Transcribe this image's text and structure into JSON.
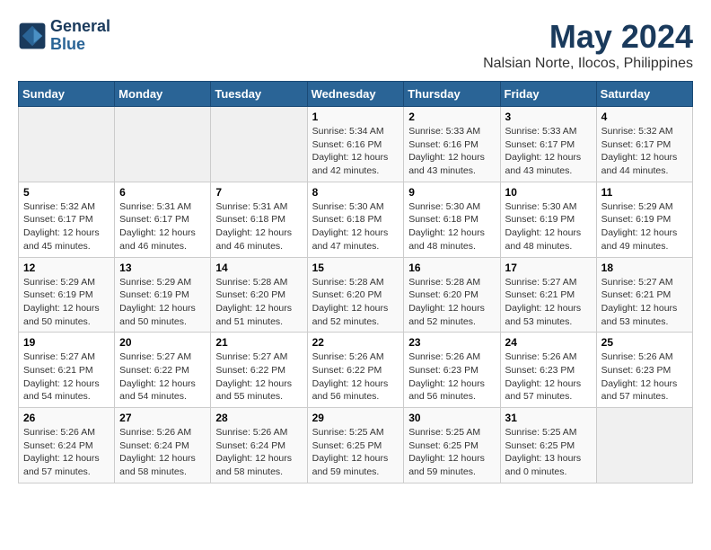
{
  "header": {
    "logo_line1": "General",
    "logo_line2": "Blue",
    "title": "May 2024",
    "subtitle": "Nalsian Norte, Ilocos, Philippines"
  },
  "weekdays": [
    "Sunday",
    "Monday",
    "Tuesday",
    "Wednesday",
    "Thursday",
    "Friday",
    "Saturday"
  ],
  "weeks": [
    [
      {
        "day": "",
        "info": ""
      },
      {
        "day": "",
        "info": ""
      },
      {
        "day": "",
        "info": ""
      },
      {
        "day": "1",
        "info": "Sunrise: 5:34 AM\nSunset: 6:16 PM\nDaylight: 12 hours\nand 42 minutes."
      },
      {
        "day": "2",
        "info": "Sunrise: 5:33 AM\nSunset: 6:16 PM\nDaylight: 12 hours\nand 43 minutes."
      },
      {
        "day": "3",
        "info": "Sunrise: 5:33 AM\nSunset: 6:17 PM\nDaylight: 12 hours\nand 43 minutes."
      },
      {
        "day": "4",
        "info": "Sunrise: 5:32 AM\nSunset: 6:17 PM\nDaylight: 12 hours\nand 44 minutes."
      }
    ],
    [
      {
        "day": "5",
        "info": "Sunrise: 5:32 AM\nSunset: 6:17 PM\nDaylight: 12 hours\nand 45 minutes."
      },
      {
        "day": "6",
        "info": "Sunrise: 5:31 AM\nSunset: 6:17 PM\nDaylight: 12 hours\nand 46 minutes."
      },
      {
        "day": "7",
        "info": "Sunrise: 5:31 AM\nSunset: 6:18 PM\nDaylight: 12 hours\nand 46 minutes."
      },
      {
        "day": "8",
        "info": "Sunrise: 5:30 AM\nSunset: 6:18 PM\nDaylight: 12 hours\nand 47 minutes."
      },
      {
        "day": "9",
        "info": "Sunrise: 5:30 AM\nSunset: 6:18 PM\nDaylight: 12 hours\nand 48 minutes."
      },
      {
        "day": "10",
        "info": "Sunrise: 5:30 AM\nSunset: 6:19 PM\nDaylight: 12 hours\nand 48 minutes."
      },
      {
        "day": "11",
        "info": "Sunrise: 5:29 AM\nSunset: 6:19 PM\nDaylight: 12 hours\nand 49 minutes."
      }
    ],
    [
      {
        "day": "12",
        "info": "Sunrise: 5:29 AM\nSunset: 6:19 PM\nDaylight: 12 hours\nand 50 minutes."
      },
      {
        "day": "13",
        "info": "Sunrise: 5:29 AM\nSunset: 6:19 PM\nDaylight: 12 hours\nand 50 minutes."
      },
      {
        "day": "14",
        "info": "Sunrise: 5:28 AM\nSunset: 6:20 PM\nDaylight: 12 hours\nand 51 minutes."
      },
      {
        "day": "15",
        "info": "Sunrise: 5:28 AM\nSunset: 6:20 PM\nDaylight: 12 hours\nand 52 minutes."
      },
      {
        "day": "16",
        "info": "Sunrise: 5:28 AM\nSunset: 6:20 PM\nDaylight: 12 hours\nand 52 minutes."
      },
      {
        "day": "17",
        "info": "Sunrise: 5:27 AM\nSunset: 6:21 PM\nDaylight: 12 hours\nand 53 minutes."
      },
      {
        "day": "18",
        "info": "Sunrise: 5:27 AM\nSunset: 6:21 PM\nDaylight: 12 hours\nand 53 minutes."
      }
    ],
    [
      {
        "day": "19",
        "info": "Sunrise: 5:27 AM\nSunset: 6:21 PM\nDaylight: 12 hours\nand 54 minutes."
      },
      {
        "day": "20",
        "info": "Sunrise: 5:27 AM\nSunset: 6:22 PM\nDaylight: 12 hours\nand 54 minutes."
      },
      {
        "day": "21",
        "info": "Sunrise: 5:27 AM\nSunset: 6:22 PM\nDaylight: 12 hours\nand 55 minutes."
      },
      {
        "day": "22",
        "info": "Sunrise: 5:26 AM\nSunset: 6:22 PM\nDaylight: 12 hours\nand 56 minutes."
      },
      {
        "day": "23",
        "info": "Sunrise: 5:26 AM\nSunset: 6:23 PM\nDaylight: 12 hours\nand 56 minutes."
      },
      {
        "day": "24",
        "info": "Sunrise: 5:26 AM\nSunset: 6:23 PM\nDaylight: 12 hours\nand 57 minutes."
      },
      {
        "day": "25",
        "info": "Sunrise: 5:26 AM\nSunset: 6:23 PM\nDaylight: 12 hours\nand 57 minutes."
      }
    ],
    [
      {
        "day": "26",
        "info": "Sunrise: 5:26 AM\nSunset: 6:24 PM\nDaylight: 12 hours\nand 57 minutes."
      },
      {
        "day": "27",
        "info": "Sunrise: 5:26 AM\nSunset: 6:24 PM\nDaylight: 12 hours\nand 58 minutes."
      },
      {
        "day": "28",
        "info": "Sunrise: 5:26 AM\nSunset: 6:24 PM\nDaylight: 12 hours\nand 58 minutes."
      },
      {
        "day": "29",
        "info": "Sunrise: 5:25 AM\nSunset: 6:25 PM\nDaylight: 12 hours\nand 59 minutes."
      },
      {
        "day": "30",
        "info": "Sunrise: 5:25 AM\nSunset: 6:25 PM\nDaylight: 12 hours\nand 59 minutes."
      },
      {
        "day": "31",
        "info": "Sunrise: 5:25 AM\nSunset: 6:25 PM\nDaylight: 13 hours\nand 0 minutes."
      },
      {
        "day": "",
        "info": ""
      }
    ]
  ]
}
